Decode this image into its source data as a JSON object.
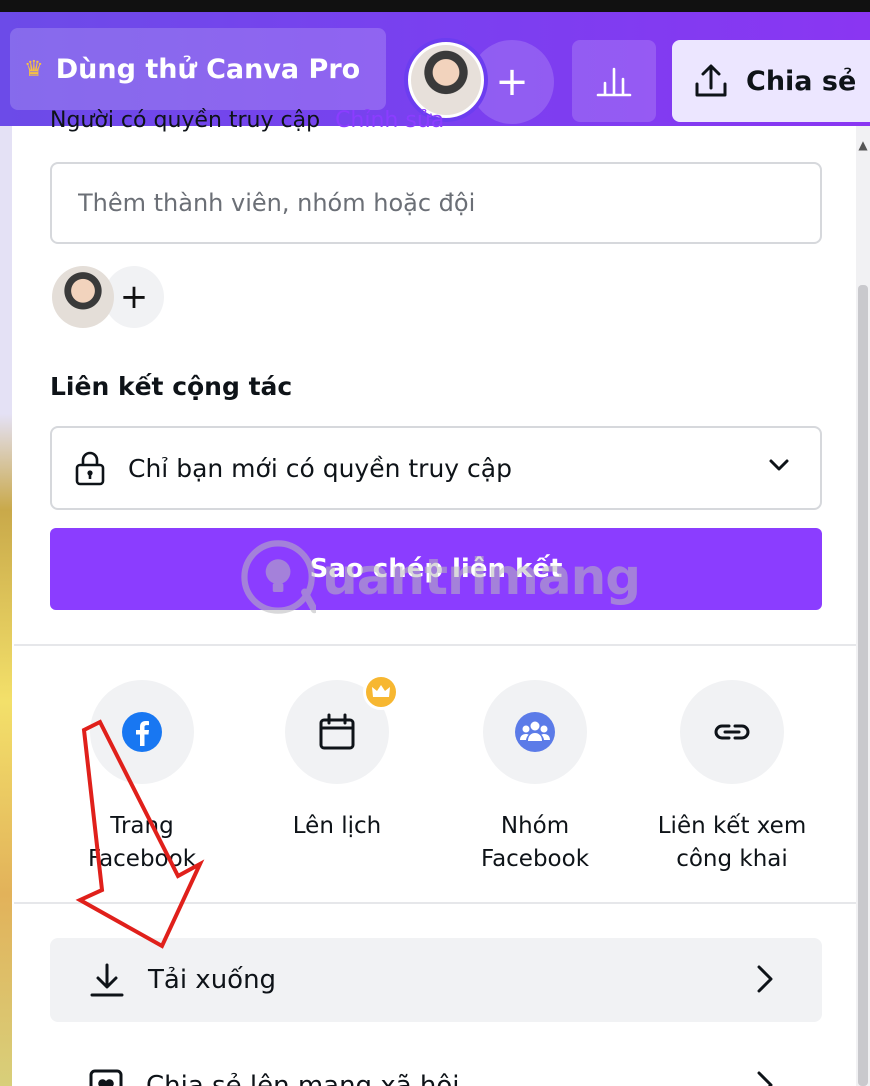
{
  "topbar": {
    "trial_label": "Dùng thử Canva Pro",
    "share_label": "Chia sẻ"
  },
  "panel": {
    "cut_heading": "Người có quyền truy cập",
    "cut_edit": "Chỉnh sửa",
    "member_input_placeholder": "Thêm thành viên, nhóm hoặc đội",
    "collab_title": "Liên kết cộng tác",
    "access_value": "Chỉ bạn mới có quyền truy cập",
    "copy_link_label": "Sao chép liên kết",
    "share_options": [
      {
        "label_line1": "Trang",
        "label_line2": "Facebook",
        "icon": "facebook-icon"
      },
      {
        "label_line1": "Lên lịch",
        "label_line2": "",
        "icon": "calendar-icon",
        "pro": true
      },
      {
        "label_line1": "Nhóm",
        "label_line2": "Facebook",
        "icon": "facebook-group-icon"
      },
      {
        "label_line1": "Liên kết xem",
        "label_line2": "công khai",
        "icon": "link-icon"
      }
    ],
    "download_label": "Tải xuống",
    "social_label": "Chia sẻ lên mạng xã hội"
  },
  "watermark": "uantrimang",
  "colors": {
    "brand_purple": "#8b3dff",
    "topbar_gradient_start": "#6c4be8",
    "topbar_gradient_end": "#8a36f2",
    "facebook_blue": "#1877f2",
    "pro_gold": "#f7b731",
    "arrow_red": "#e0201b"
  }
}
